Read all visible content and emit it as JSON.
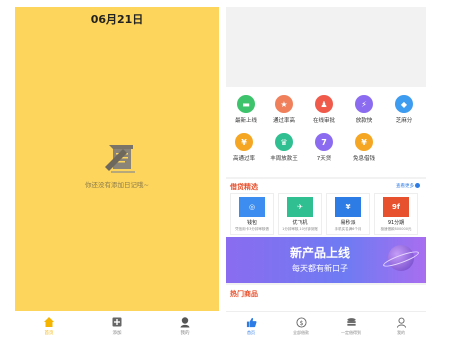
{
  "left_screen": {
    "date": "06月21日",
    "empty_text": "你还没有添加日记哦~",
    "tabs": [
      {
        "label": "首页",
        "icon": "home-icon"
      },
      {
        "label": "添加",
        "icon": "add-note-icon"
      },
      {
        "label": "我的",
        "icon": "user-avatar-icon"
      }
    ]
  },
  "right_screen": {
    "quick_icons": [
      {
        "label": "最新上线",
        "color": "#3cc36b",
        "glyph": "▬"
      },
      {
        "label": "通过率高",
        "color": "#f0805b",
        "glyph": "★"
      },
      {
        "label": "在线审批",
        "color": "#ef5a4b",
        "glyph": "♟"
      },
      {
        "label": "放款快",
        "color": "#8b6cf0",
        "glyph": "⚡"
      },
      {
        "label": "芝麻分",
        "color": "#3d9bf0",
        "glyph": "◆"
      },
      {
        "label": "高通过率",
        "color": "#f5a623",
        "glyph": "¥"
      },
      {
        "label": "丰周放款王",
        "color": "#2fbf90",
        "glyph": "♛"
      },
      {
        "label": "7天贷",
        "color": "#8b6cf0",
        "glyph": "7"
      },
      {
        "label": "免息借钱",
        "color": "#f5a623",
        "glyph": "¥"
      }
    ],
    "section1_title": "借贷精选",
    "section1_more": "查看更多",
    "cards": [
      {
        "name": "钱包",
        "desc": "凭信用卡3分钟审核借",
        "color": "#3d8cf0",
        "glyph": "◎"
      },
      {
        "name": "优飞机",
        "desc": "1分钟审核,10分钟到账",
        "color": "#2fbf90",
        "glyph": "✈"
      },
      {
        "name": "易秒派",
        "desc": "手机实名满6个月",
        "color": "#2d7be5",
        "glyph": "¥"
      },
      {
        "name": "91分期",
        "desc": "极速借款800000元",
        "color": "#e8512e",
        "glyph": "9f"
      }
    ],
    "banner_title": "新产品上线",
    "banner_subtitle": "每天都有新口子",
    "hot_title": "热门商品",
    "tabs": [
      {
        "label": "首页",
        "icon": "thumbs-up-icon"
      },
      {
        "label": "全部借款",
        "icon": "dollar-circle-icon"
      },
      {
        "label": "一定借得到",
        "icon": "database-icon"
      },
      {
        "label": "我的",
        "icon": "person-icon"
      }
    ]
  },
  "colors": {
    "left_bg": "#fdd55c",
    "accent_blue": "#2d7be5",
    "section_red": "#e8512e"
  }
}
